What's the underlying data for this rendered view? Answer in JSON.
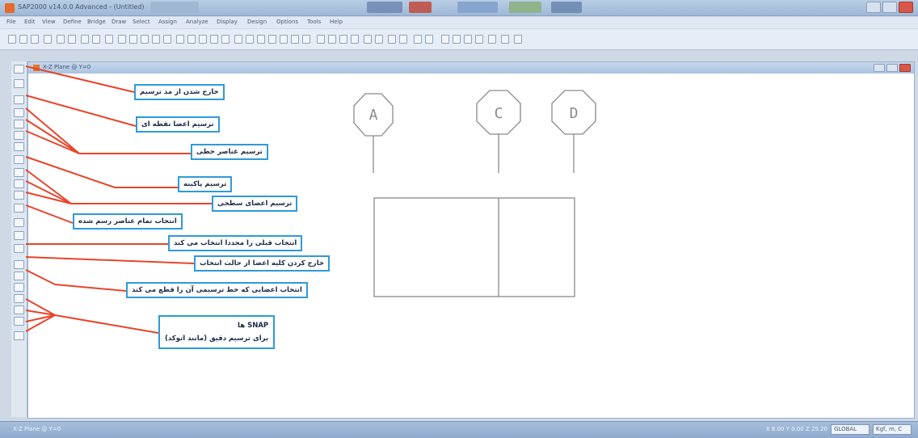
{
  "app": {
    "title": "SAP2000 v14.0.0 Advanced - (Untitled)"
  },
  "menubar": {
    "items": [
      "File",
      "Edit",
      "View",
      "Define",
      "Bridge",
      "Draw",
      "Select",
      "Assign",
      "Analyze",
      "Display",
      "Design",
      "Options",
      "Tools",
      "Help"
    ]
  },
  "document": {
    "title": "X-Z Plane @ Y=0"
  },
  "canvas": {
    "grid_bubbles": [
      {
        "label": "A"
      },
      {
        "label": "C"
      },
      {
        "label": "D"
      }
    ]
  },
  "callouts": [
    {
      "name": "callout-exit-draw-mode",
      "text": "خارج شدن از مد ترسیم"
    },
    {
      "name": "callout-draw-point-object",
      "text": "ترسیم اعضا نقطه ای"
    },
    {
      "name": "callout-draw-line-elements",
      "text": "ترسیم عناصر خطی"
    },
    {
      "name": "callout-draw-link",
      "text": "ترسیم پاکینه"
    },
    {
      "name": "callout-draw-area-objects",
      "text": "ترسیم اعضای سطحی"
    },
    {
      "name": "callout-select-all",
      "text": "انتخاب تمام عناصر رسم شده"
    },
    {
      "name": "callout-get-previous-selection",
      "text": "انتخاب قبلی را مجددا انتخاب می کند"
    },
    {
      "name": "callout-clear-selection",
      "text": "خارج کردن کلیه اعضا از حالت انتخاب"
    },
    {
      "name": "callout-intersecting-line-select",
      "text": "انتخاب اعضایی که خط ترسیمی آن را قطع می کند"
    }
  ],
  "snap_callout": {
    "line1": "SNAP ها",
    "line2": "برای ترسیم دقیق (مانند اتوکد)"
  },
  "statusbar": {
    "left": "X-Z Plane @ Y=0",
    "right": "X 8.00 Y 0.00 Z 25.20",
    "coord_system": "GLOBAL",
    "units": "Kgf, m, C"
  },
  "colors": {
    "callout_border": "#2f9ad8",
    "leader_line": "#e8442a",
    "drawing_line": "#8a8a8a",
    "accent_brand": "#e86a2a"
  }
}
